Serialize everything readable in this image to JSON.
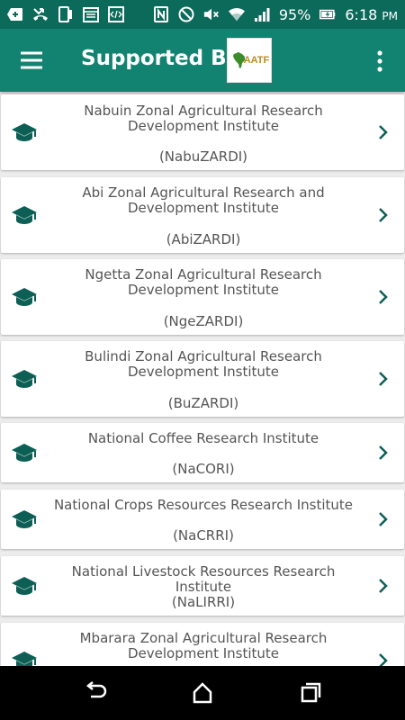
{
  "status_bar": {
    "battery_percent": "95%",
    "time": "6:18",
    "ampm": "PM",
    "icons": [
      "add-icon",
      "missed-call-icon",
      "phone-icon",
      "calendar-icon",
      "code-icon",
      "nfc-icon",
      "do-not-disturb-icon",
      "mute-icon",
      "wifi-icon",
      "signal-icon",
      "battery-charging-icon"
    ]
  },
  "app_bar": {
    "title": "Supported By",
    "logo_text": "AATF",
    "colors": {
      "primary": "#138371",
      "status": "#0c6a5b",
      "icon": "#0d5f55"
    }
  },
  "institutes": [
    {
      "name": "Nabuin Zonal Agricultural Research Development Institute",
      "abbr": "(NabuZARDI)"
    },
    {
      "name": "Abi Zonal Agricultural Research and Development Institute",
      "abbr": "(AbiZARDI)"
    },
    {
      "name": "Ngetta Zonal Agricultural Research Development Institute",
      "abbr": "(NgeZARDI)"
    },
    {
      "name": "Bulindi Zonal Agricultural Research Development Institute",
      "abbr": "(BuZARDI)"
    },
    {
      "name": "National Coffee Research Institute",
      "abbr": "(NaCORI)"
    },
    {
      "name": "National Crops Resources Research Institute",
      "abbr": "(NaCRRI)"
    },
    {
      "name": "National Livestock Resources Research Institute",
      "abbr": "(NaLIRRI)"
    },
    {
      "name": "Mbarara Zonal Agricultural Research Development Institute",
      "abbr": ""
    }
  ]
}
